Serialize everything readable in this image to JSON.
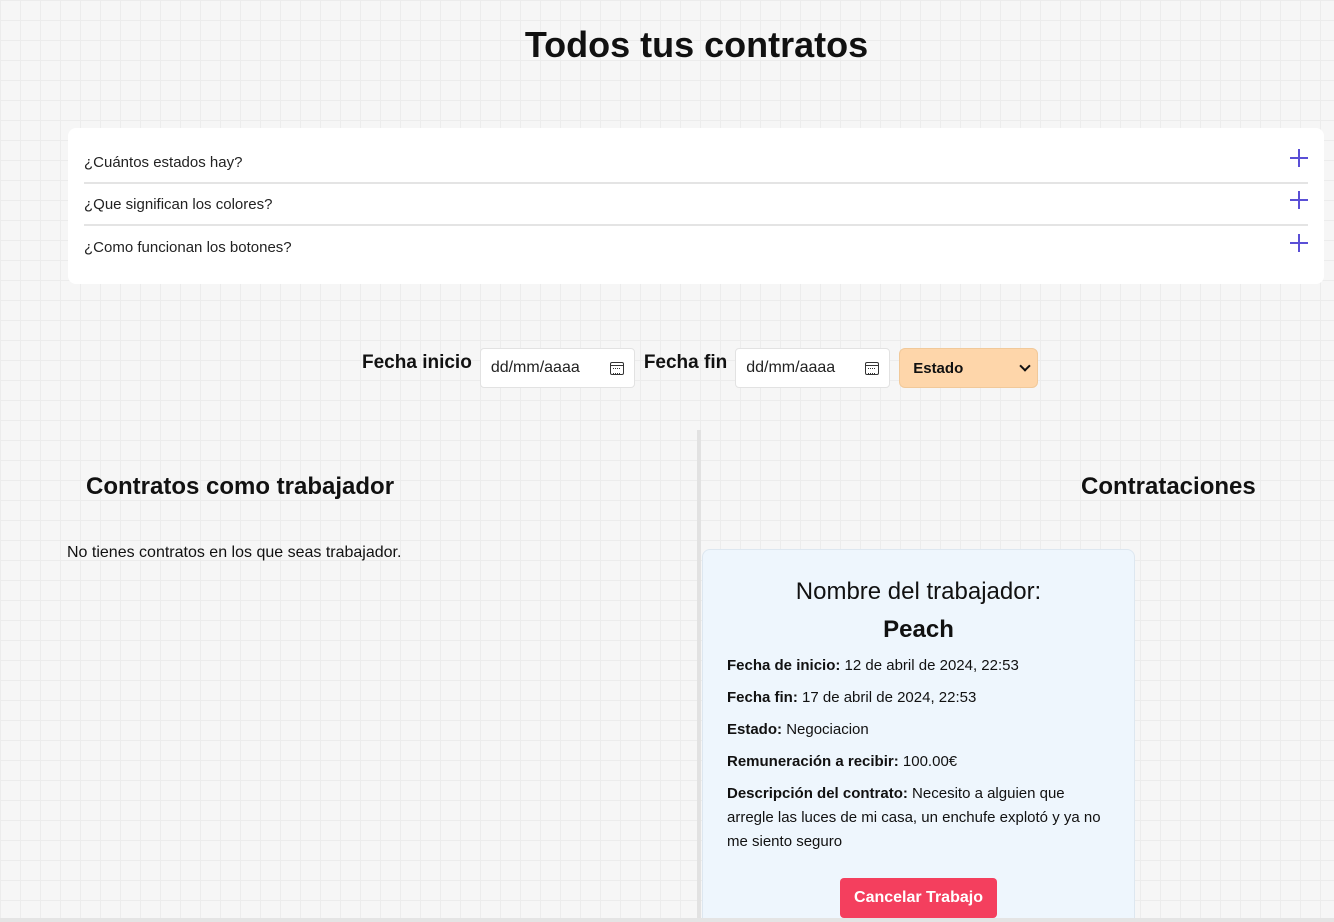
{
  "page": {
    "title": "Todos tus contratos"
  },
  "faq": {
    "items": [
      {
        "question": "¿Cuántos estados hay?"
      },
      {
        "question": "¿Que significan los colores?"
      },
      {
        "question": "¿Como funcionan los botones?"
      }
    ]
  },
  "filters": {
    "start_label": "Fecha inicio",
    "start_placeholder": "dd/mm/aaaa",
    "end_label": "Fecha fin",
    "end_placeholder": "dd/mm/aaaa",
    "estado_selected": "Estado",
    "estado_color": "#fed6aa"
  },
  "left_column": {
    "title": "Contratos como trabajador",
    "empty_message": "No tienes contratos en los que seas trabajador."
  },
  "right_column": {
    "title": "Contrataciones",
    "contract": {
      "heading": "Nombre del trabajador:",
      "worker_name": "Peach",
      "start_label": "Fecha de inicio:",
      "start_value": "12 de abril de 2024, 22:53",
      "end_label": "Fecha fin:",
      "end_value": "17 de abril de 2024, 22:53",
      "status_label": "Estado:",
      "status_value": "Negociacion",
      "pay_label": "Remuneración a recibir:",
      "pay_value": "100.00€",
      "desc_label": "Descripción del contrato:",
      "desc_value": "Necesito a alguien que arregle las luces de mi casa, un enchufe explotó y ya no me siento seguro",
      "cancel_label": "Cancelar Trabajo",
      "cancel_color": "#f43f5e"
    }
  }
}
